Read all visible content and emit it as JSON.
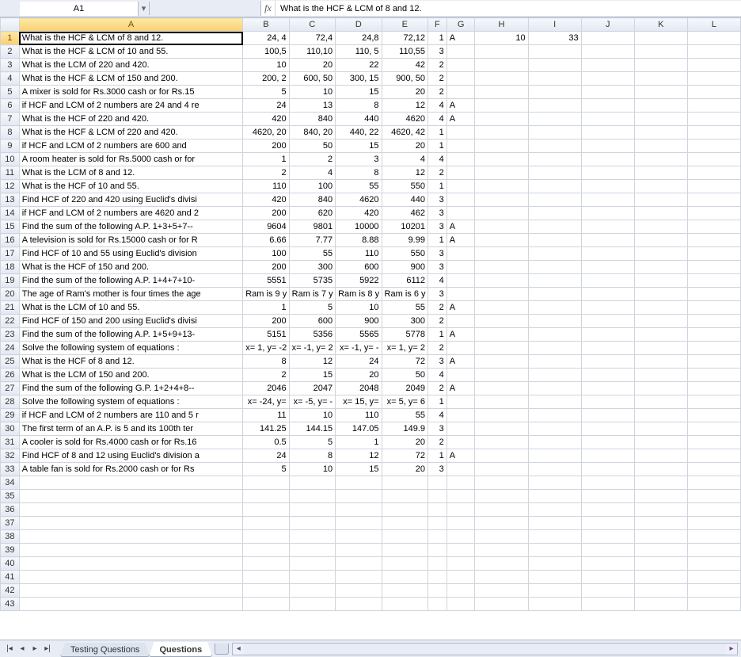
{
  "name_box": "A1",
  "formula_bar": "What is the HCF & LCM of 8 and 12.",
  "columns": [
    "A",
    "B",
    "C",
    "D",
    "E",
    "F",
    "G",
    "H",
    "I",
    "J",
    "K",
    "L"
  ],
  "active_cell": {
    "row": 1,
    "col": "A"
  },
  "rows": [
    {
      "n": 1,
      "A": "What is the HCF & LCM of 8 and 12.",
      "B": "24, 4",
      "C": "72,4",
      "D": "24,8",
      "E": "72,12",
      "F": "1",
      "G": "A",
      "H": "10",
      "I": "33"
    },
    {
      "n": 2,
      "A": "What is the HCF & LCM of 10 and 55.",
      "B": "100,5",
      "C": "110,10",
      "D": "110, 5",
      "E": "110,55",
      "F": "3"
    },
    {
      "n": 3,
      "A": "What is the LCM of 220 and 420.",
      "B": "10",
      "C": "20",
      "D": "22",
      "E": "42",
      "F": "2"
    },
    {
      "n": 4,
      "A": "What is the HCF & LCM of 150 and 200.",
      "B": "200, 2",
      "C": "600, 50",
      "D": "300, 15",
      "E": "900, 50",
      "F": "2"
    },
    {
      "n": 5,
      "A": "A mixer is sold for Rs.3000 cash or for Rs.15",
      "B": "5",
      "C": "10",
      "D": "15",
      "E": "20",
      "F": "2"
    },
    {
      "n": 6,
      "A": "if HCF and LCM of 2 numbers are 24 and 4 re",
      "B": "24",
      "C": "13",
      "D": "8",
      "E": "12",
      "F": "4",
      "G": "A"
    },
    {
      "n": 7,
      "A": "What is the HCF of 220 and 420.",
      "B": "420",
      "C": "840",
      "D": "440",
      "E": "4620",
      "F": "4",
      "G": "A"
    },
    {
      "n": 8,
      "A": "What is the HCF & LCM of 220 and 420.",
      "B": "4620, 20",
      "C": "840, 20",
      "D": "440, 22",
      "E": "4620, 42",
      "F": "1"
    },
    {
      "n": 9,
      "A": "if HCF and LCM of 2 numbers are 600 and",
      "B": "200",
      "C": "50",
      "D": "15",
      "E": "20",
      "F": "1"
    },
    {
      "n": 10,
      "A": "A room heater is sold for Rs.5000 cash or for",
      "B": "1",
      "C": "2",
      "D": "3",
      "E": "4",
      "F": "4"
    },
    {
      "n": 11,
      "A": "What is the LCM of 8 and 12.",
      "B": "2",
      "C": "4",
      "D": "8",
      "E": "12",
      "F": "2"
    },
    {
      "n": 12,
      "A": "What is the HCF of 10 and 55.",
      "B": "110",
      "C": "100",
      "D": "55",
      "E": "550",
      "F": "1"
    },
    {
      "n": 13,
      "A": "Find HCF of 220 and 420 using Euclid's divisi",
      "B": "420",
      "C": "840",
      "D": "4620",
      "E": "440",
      "F": "3"
    },
    {
      "n": 14,
      "A": "if HCF and LCM of 2 numbers are 4620 and 2",
      "B": "200",
      "C": "620",
      "D": "420",
      "E": "462",
      "F": "3"
    },
    {
      "n": 15,
      "A": "Find the sum of the following A.P. 1+3+5+7--",
      "B": "9604",
      "C": "9801",
      "D": "10000",
      "E": "10201",
      "F": "3",
      "G": "A"
    },
    {
      "n": 16,
      "A": "A television is sold for Rs.15000 cash or for R",
      "B": "6.66",
      "C": "7.77",
      "D": "8.88",
      "E": "9.99",
      "F": "1",
      "G": "A"
    },
    {
      "n": 17,
      "A": "Find HCF of 10 and 55 using Euclid's division",
      "B": "100",
      "C": "55",
      "D": "110",
      "E": "550",
      "F": "3"
    },
    {
      "n": 18,
      "A": "What is the HCF of 150 and 200.",
      "B": "200",
      "C": "300",
      "D": "600",
      "E": "900",
      "F": "3"
    },
    {
      "n": 19,
      "A": "Find the sum of the following A.P. 1+4+7+10-",
      "B": "5551",
      "C": "5735",
      "D": "5922",
      "E": "6112",
      "F": "4"
    },
    {
      "n": 20,
      "A": "The age of Ram's mother is four times the age",
      "B": "Ram is 9 y",
      "C": "Ram is 7 y",
      "D": "Ram is 8 y",
      "E": "Ram is 6 y",
      "F": "3"
    },
    {
      "n": 21,
      "A": "What is the LCM of 10 and 55.",
      "B": "1",
      "C": "5",
      "D": "10",
      "E": "55",
      "F": "2",
      "G": "A"
    },
    {
      "n": 22,
      "A": "Find HCF of 150 and 200 using Euclid's divisi",
      "B": "200",
      "C": "600",
      "D": "900",
      "E": "300",
      "F": "2"
    },
    {
      "n": 23,
      "A": "Find the sum of the following A.P. 1+5+9+13-",
      "B": "5151",
      "C": "5356",
      "D": "5565",
      "E": "5778",
      "F": "1",
      "G": "A"
    },
    {
      "n": 24,
      "A": "Solve the following system of equations :",
      "B": "x= 1, y= -2",
      "C": "x= -1, y= 2",
      "D": "x= -1, y= -",
      "E": "x= 1, y= 2",
      "F": "2"
    },
    {
      "n": 25,
      "A": "What is the HCF of 8 and 12.",
      "B": "8",
      "C": "12",
      "D": "24",
      "E": "72",
      "F": "3",
      "G": "A"
    },
    {
      "n": 26,
      "A": "What is the LCM of 150 and 200.",
      "B": "2",
      "C": "15",
      "D": "20",
      "E": "50",
      "F": "4"
    },
    {
      "n": 27,
      "A": "Find the sum of the following G.P. 1+2+4+8--",
      "B": "2046",
      "C": "2047",
      "D": "2048",
      "E": "2049",
      "F": "2",
      "G": "A"
    },
    {
      "n": 28,
      "A": "Solve the following system of equations :",
      "B": "x= -24, y=",
      "C": "x= -5, y= -",
      "D": "x= 15, y=",
      "E": "x= 5, y= 6",
      "F": "1"
    },
    {
      "n": 29,
      "A": "if HCF and LCM of 2 numbers are 110 and 5 r",
      "B": "11",
      "C": "10",
      "D": "110",
      "E": "55",
      "F": "4"
    },
    {
      "n": 30,
      "A": "The first term of an A.P. is 5 and its 100th ter",
      "B": "141.25",
      "C": "144.15",
      "D": "147.05",
      "E": "149.9",
      "F": "3"
    },
    {
      "n": 31,
      "A": "A cooler is sold for Rs.4000 cash or for Rs.16",
      "B": "0.5",
      "C": "5",
      "D": "1",
      "E": "20",
      "F": "2"
    },
    {
      "n": 32,
      "A": "Find HCF of 8 and 12 using Euclid's division a",
      "B": "24",
      "C": "8",
      "D": "12",
      "E": "72",
      "F": "1",
      "G": "A"
    },
    {
      "n": 33,
      "A": "A table fan is sold for Rs.2000 cash or for Rs",
      "B": "5",
      "C": "10",
      "D": "15",
      "E": "20",
      "F": "3"
    },
    {
      "n": 34
    },
    {
      "n": 35
    },
    {
      "n": 36
    },
    {
      "n": 37
    },
    {
      "n": 38
    },
    {
      "n": 39
    },
    {
      "n": 40
    },
    {
      "n": 41
    },
    {
      "n": 42
    },
    {
      "n": 43
    }
  ],
  "sheet_tabs": {
    "tabs": [
      "Testing Questions",
      "Questions"
    ],
    "active": "Questions"
  }
}
